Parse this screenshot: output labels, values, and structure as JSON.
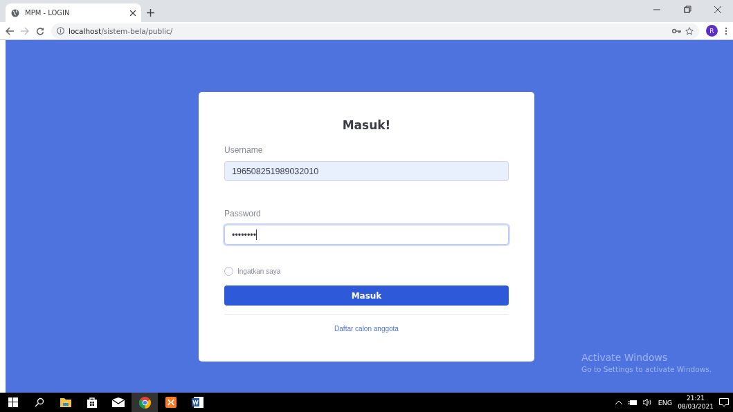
{
  "browser": {
    "tab": {
      "title": "MPM - LOGIN",
      "selected": true
    },
    "url": {
      "host": "localhost",
      "path": "/sistem-bela/public/"
    },
    "profile_initial": "R"
  },
  "login_card": {
    "title": "Masuk!",
    "fields": [
      {
        "label": "Username",
        "value": "196508251989032010",
        "autofilled": true,
        "focused": false
      },
      {
        "label": "Password",
        "value": "••••••••",
        "autofilled": false,
        "focused": true
      }
    ],
    "remember": {
      "label": "Ingatkan saya",
      "checked": false
    },
    "submit": "Masuk",
    "register_link": "Daftar calon anggota"
  },
  "activation_notice": {
    "title": "Activate Windows",
    "message": "Go to Settings to activate Windows."
  },
  "taskbar": {
    "apps": [
      {
        "kind": "start",
        "selected": false
      },
      {
        "kind": "search",
        "selected": false
      },
      {
        "kind": "folder",
        "selected": false
      },
      {
        "kind": "store",
        "selected": false
      },
      {
        "kind": "mail",
        "selected": false
      },
      {
        "kind": "browser",
        "selected": true
      },
      {
        "kind": "server",
        "selected": false
      },
      {
        "kind": "word",
        "selected": false
      }
    ],
    "language": "ENG",
    "time": "21:21",
    "date": "08/03/2021"
  }
}
